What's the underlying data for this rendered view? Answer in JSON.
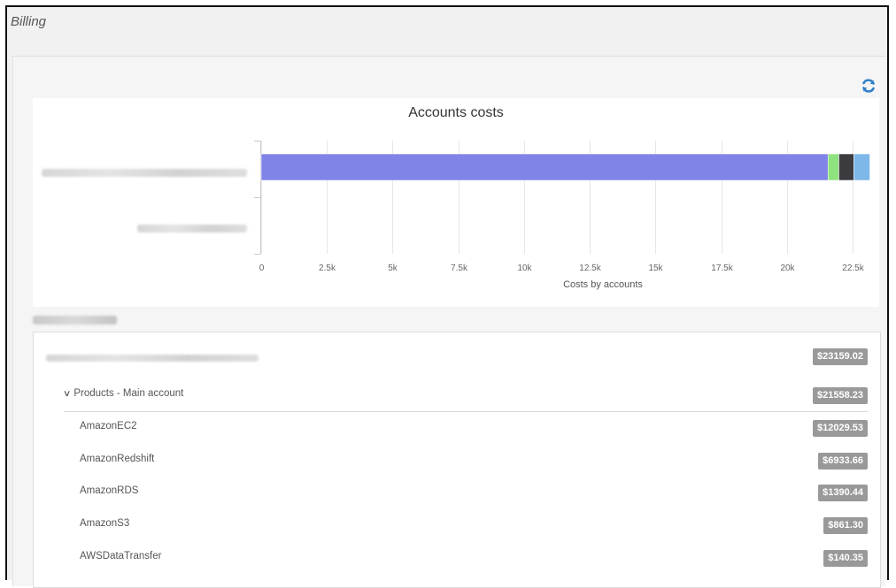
{
  "page": {
    "title": "Billing"
  },
  "toolbar": {
    "refresh_icon": "refresh-icon"
  },
  "chart_data": {
    "type": "bar",
    "orientation": "horizontal",
    "stacked": true,
    "title": "Accounts costs",
    "xlabel": "Costs by accounts",
    "ylabel": "",
    "xlim": [
      0,
      23300
    ],
    "x_ticks": [
      0,
      2500,
      5000,
      7500,
      10000,
      12500,
      15000,
      17500,
      20000,
      22500
    ],
    "x_tick_labels": [
      "0",
      "2.5k",
      "5k",
      "7.5k",
      "10k",
      "12.5k",
      "15k",
      "17.5k",
      "20k",
      "22.5k"
    ],
    "categories": [
      "account-1",
      "account-2"
    ],
    "series": [
      {
        "values": [
          21558.23,
          0
        ],
        "color": "#7f84e6"
      },
      {
        "values": [
          410,
          0
        ],
        "color": "#8fe37f"
      },
      {
        "values": [
          570,
          0
        ],
        "color": "#3b3b40"
      },
      {
        "values": [
          611,
          0
        ],
        "color": "#7eb7ea"
      }
    ],
    "grid": true
  },
  "accounts": {
    "total": "$23159.02",
    "group": {
      "label": "Products - Main account",
      "total": "$21558.23",
      "items": [
        {
          "label": "AmazonEC2",
          "value": "$12029.53"
        },
        {
          "label": "AmazonRedshift",
          "value": "$6933.66"
        },
        {
          "label": "AmazonRDS",
          "value": "$1390.44"
        },
        {
          "label": "AmazonS3",
          "value": "$861.30"
        },
        {
          "label": "AWSDataTransfer",
          "value": "$140.35"
        }
      ]
    }
  }
}
